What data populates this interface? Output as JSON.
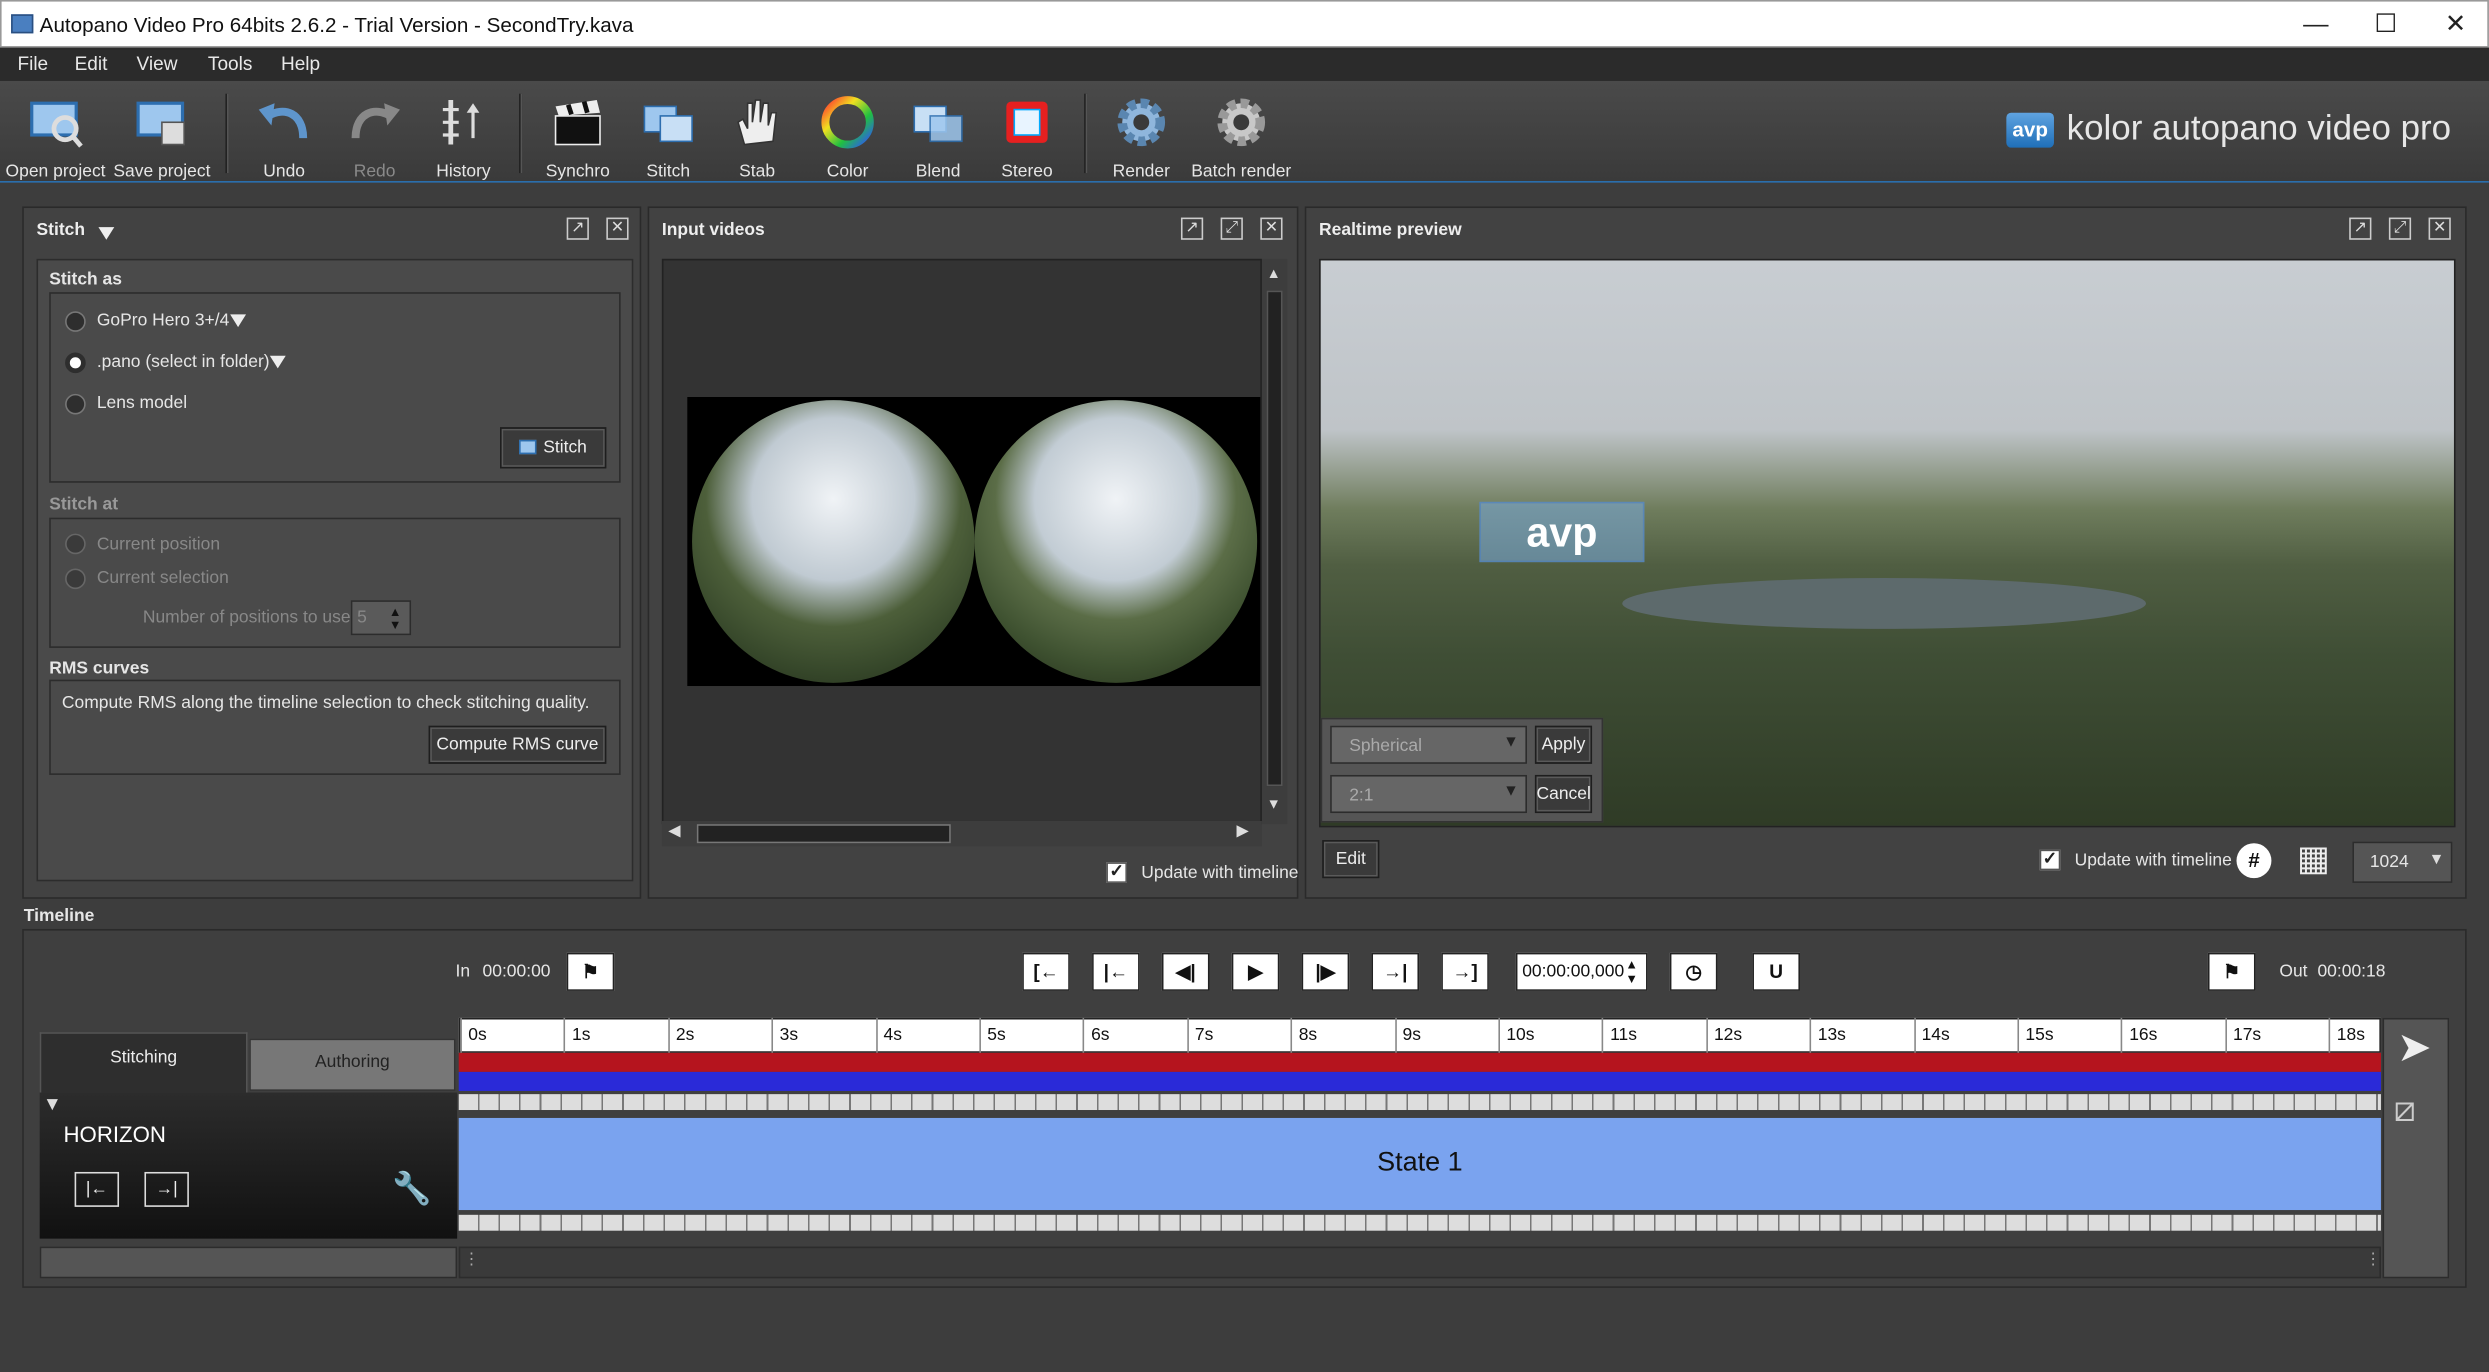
{
  "window": {
    "title": "Autopano Video Pro 64bits 2.6.2 - Trial Version - SecondTry.kava"
  },
  "menu": [
    "File",
    "Edit",
    "View",
    "Tools",
    "Help"
  ],
  "toolbar": {
    "open": "Open project",
    "save": "Save project",
    "undo": "Undo",
    "redo": "Redo",
    "history": "History",
    "synchro": "Synchro",
    "stitch": "Stitch",
    "stab": "Stab",
    "color": "Color",
    "blend": "Blend",
    "stereo": "Stereo",
    "render": "Render",
    "batch": "Batch render"
  },
  "brand": {
    "logo": "avp",
    "name": "kolor autopano video pro"
  },
  "stitch_panel": {
    "title": "Stitch",
    "stitch_as": "Stitch as",
    "opt1": "GoPro Hero 3+/4",
    "opt2": ".pano (select in folder)",
    "opt3": "Lens model",
    "stitch_btn": "Stitch",
    "stitch_at": "Stitch at",
    "pos1": "Current position",
    "pos2": "Current selection",
    "num_label": "Number of positions to use",
    "num_value": "5",
    "rms_title": "RMS curves",
    "rms_text": "Compute RMS along the timeline selection to check stitching quality.",
    "rms_btn": "Compute RMS curve"
  },
  "input_panel": {
    "title": "Input videos",
    "update": "Update with timeline"
  },
  "preview_panel": {
    "title": "Realtime preview",
    "projection": "Spherical",
    "ratio": "2:1",
    "apply": "Apply",
    "cancel": "Cancel",
    "edit": "Edit",
    "update": "Update with timeline",
    "resolution": "1024",
    "watermark": "avp"
  },
  "timeline": {
    "title": "Timeline",
    "in_label": "In",
    "in_time": "00:00:00",
    "out_label": "Out",
    "out_time": "00:00:18",
    "current_time": "00:00:00,000",
    "tab_stitching": "Stitching",
    "tab_authoring": "Authoring",
    "track_name": "HORIZON",
    "state": "State 1",
    "ticks": [
      "0s",
      "1s",
      "2s",
      "3s",
      "4s",
      "5s",
      "6s",
      "7s",
      "8s",
      "9s",
      "10s",
      "11s",
      "12s",
      "13s",
      "14s",
      "15s",
      "16s",
      "17s",
      "18s"
    ]
  }
}
